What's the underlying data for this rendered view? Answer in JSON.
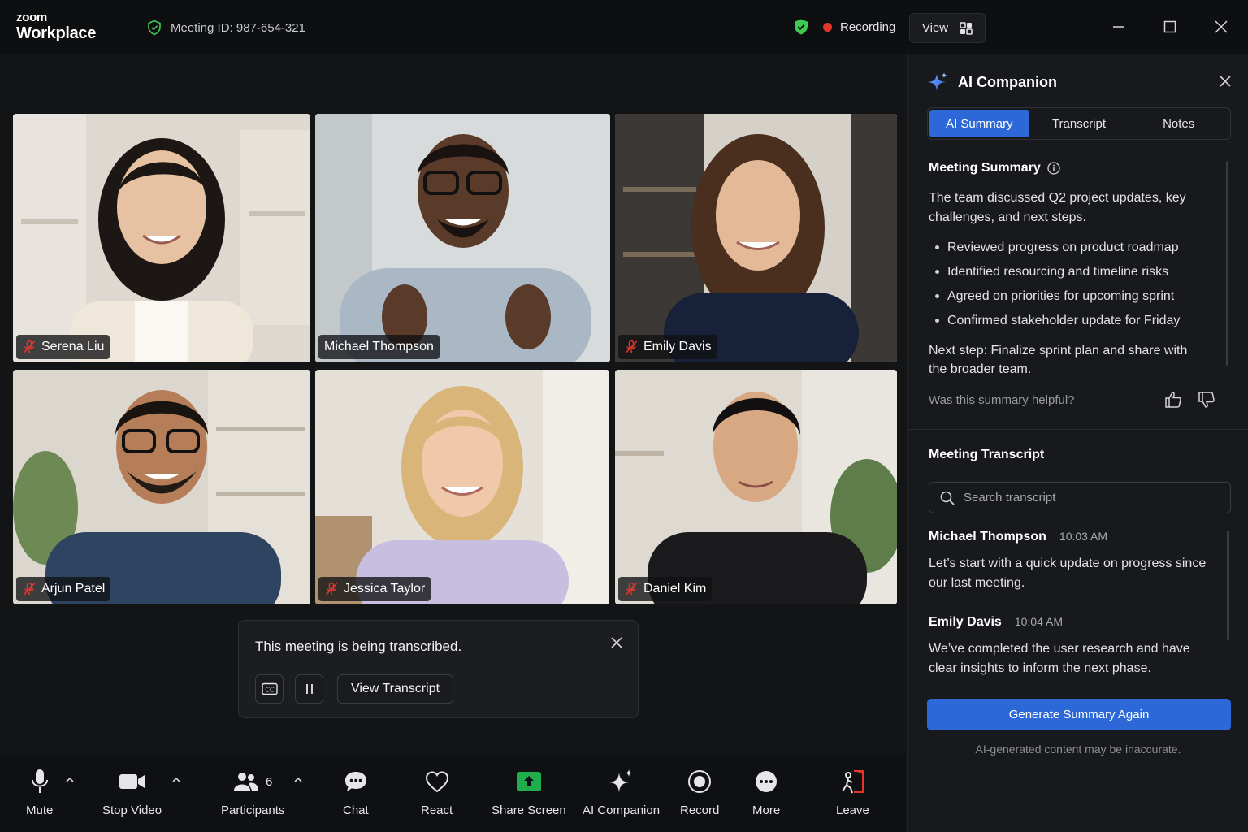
{
  "app": {
    "logo_top": "zoom",
    "logo_bottom": "Workplace",
    "meeting_id": "Meeting ID: 987-654-321",
    "recording_label": "Recording",
    "view_label": "View"
  },
  "participants": [
    {
      "name": "Serena Liu",
      "muted": true,
      "active": false
    },
    {
      "name": "Michael Thompson",
      "muted": false,
      "active": true
    },
    {
      "name": "Emily Davis",
      "muted": true,
      "active": false
    },
    {
      "name": "Arjun Patel",
      "muted": true,
      "active": false
    },
    {
      "name": "Jessica Taylor",
      "muted": true,
      "active": false
    },
    {
      "name": "Daniel Kim",
      "muted": true,
      "active": false
    }
  ],
  "toast": {
    "message": "This meeting is being transcribed.",
    "view_transcript": "View Transcript"
  },
  "toolbar": {
    "mute": "Mute",
    "stop_video": "Stop Video",
    "participants": "Participants",
    "participants_count": "6",
    "chat": "Chat",
    "react": "React",
    "share_screen": "Share Screen",
    "ai_companion": "AI Companion",
    "record": "Record",
    "more": "More",
    "leave": "Leave"
  },
  "panel": {
    "title": "AI Companion",
    "tabs": [
      "AI Summary",
      "Transcript",
      "Notes"
    ],
    "summary_title": "Meeting Summary",
    "summary_text": "The team discussed Q2 project updates, key challenges, and next steps.",
    "bullets": [
      "Reviewed progress on product roadmap",
      "Identified resourcing and timeline risks",
      "Agreed on priorities for upcoming sprint",
      "Confirmed stakeholder update for Friday"
    ],
    "next_step": "Next step: Finalize sprint plan and share with the broader team.",
    "helpful_prompt": "Was this summary helpful?",
    "transcript_title": "Meeting Transcript",
    "search_placeholder": "Search transcript",
    "entries": [
      {
        "speaker": "Michael Thompson",
        "time": "10:03 AM",
        "text": "Let’s start with a quick update on progress since our last meeting."
      },
      {
        "speaker": "Emily Davis",
        "time": "10:04 AM",
        "text": "We’ve completed the user research and have clear insights to inform the next phase."
      }
    ],
    "generate_button": "Generate Summary Again",
    "disclaimer": "AI-generated content may be inaccurate."
  },
  "colors": {
    "accent_blue": "#2d68d8",
    "active_speaker_green": "#3ecb51",
    "recording_red": "#e5352b",
    "share_green": "#1fae4b"
  }
}
